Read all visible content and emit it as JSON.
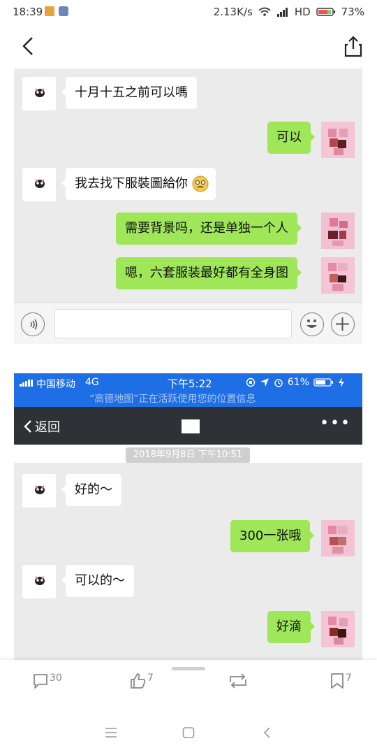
{
  "status_bar": {
    "time": "18:39",
    "network_speed": "2.13K/s",
    "signal_label": "HD",
    "battery": "73%"
  },
  "top_nav": {
    "back_icon": "chevron-left-icon",
    "share_icon": "share-icon"
  },
  "chat1": {
    "messages": [
      {
        "side": "left",
        "text": "十月十五之前可以嗎"
      },
      {
        "side": "right",
        "text": "可以"
      },
      {
        "side": "left",
        "text": "我去找下服裝圖給你"
      },
      {
        "side": "right",
        "text": "需要背景吗，还是单独一个人"
      },
      {
        "side": "right",
        "text": "嗯，六套服装最好都有全身图"
      }
    ]
  },
  "ios_status": {
    "carrier": "中国移动",
    "network": "4G",
    "time": "下午5:22",
    "battery": "61%",
    "location_banner": "“高德地图”正在活跃使用您的位置信息"
  },
  "ios_nav": {
    "back_label": "返回"
  },
  "chat2": {
    "timestamp": "2018年9月8日 下午10:51",
    "messages": [
      {
        "side": "left",
        "text": "好的～"
      },
      {
        "side": "right",
        "text": "300一张哦"
      },
      {
        "side": "left",
        "text": "可以的～"
      },
      {
        "side": "right",
        "text": "好滴"
      }
    ]
  },
  "actions": {
    "comments": "30",
    "likes": "7",
    "bookmarks": "7"
  },
  "colors": {
    "green_bubble": "#9fe658",
    "ios_blue": "#1e6fe6",
    "ios_nav": "#2e3135"
  }
}
